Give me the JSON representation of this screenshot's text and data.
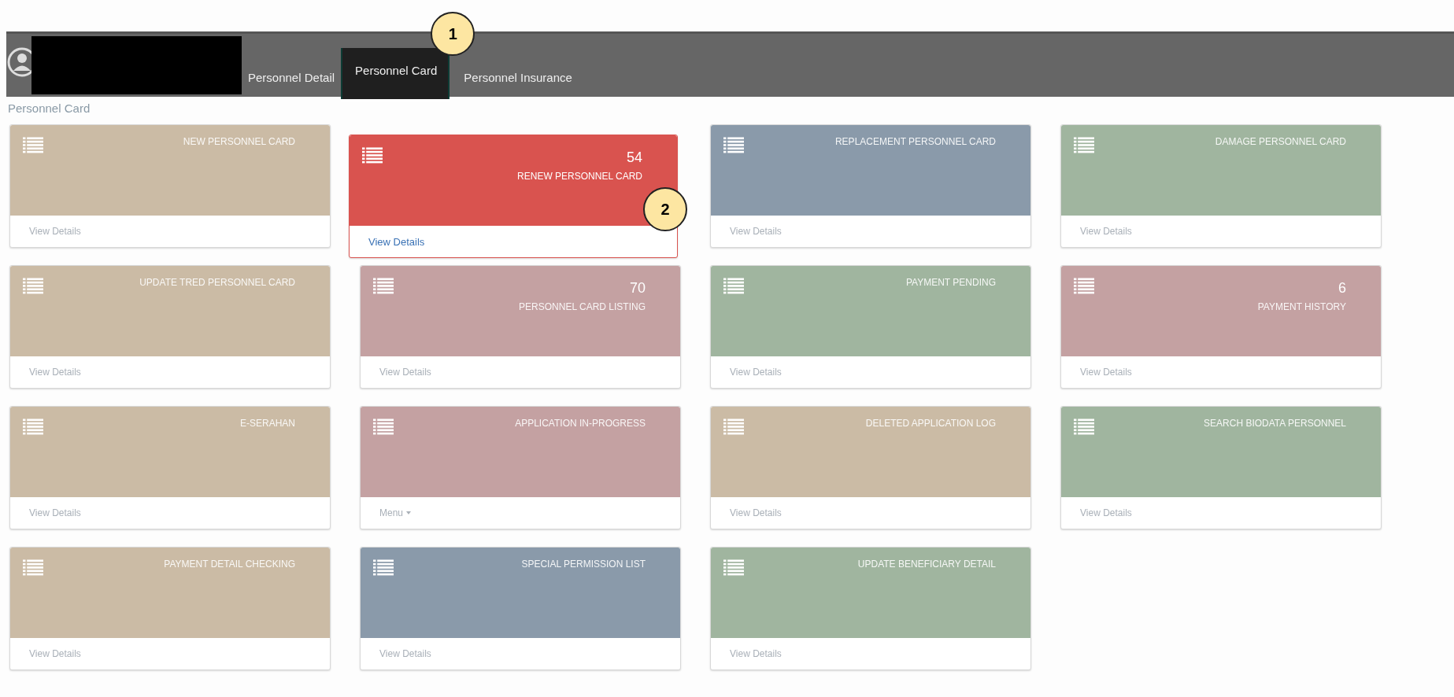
{
  "top_bar": {
    "tabs": [
      {
        "label": "Personnel Detail",
        "selected": false
      },
      {
        "label": "Personnel Card",
        "selected": true,
        "callout": "1"
      },
      {
        "label": "Personnel Insurance",
        "selected": false
      }
    ]
  },
  "breadcrumb": "Personnel Card",
  "tiles": [
    {
      "title": "NEW PERSONNEL CARD",
      "color": "#cbbba5",
      "kind": "details",
      "footer": "View Details",
      "highlighted": false
    },
    {
      "title": "RENEW PERSONNEL CARD",
      "count": "54",
      "color": "#d9534f",
      "kind": "details",
      "footer": "View Details",
      "highlighted": true,
      "callout": "2"
    },
    {
      "title": "REPLACEMENT PERSONNEL CARD",
      "color": "#8a9aaa",
      "kind": "details",
      "footer": "View Details",
      "highlighted": false
    },
    {
      "title": "DAMAGE PERSONNEL CARD",
      "color": "#a0b59f",
      "kind": "details",
      "footer": "View Details",
      "highlighted": false
    },
    {
      "title": "UPDATE TRED PERSONNEL CARD",
      "color": "#cbbba5",
      "kind": "details",
      "footer": "View Details",
      "highlighted": false
    },
    {
      "title": "PERSONNEL CARD LISTING",
      "count": "70",
      "color": "#c4a1a2",
      "kind": "details",
      "footer": "View Details",
      "highlighted": false
    },
    {
      "title": "PAYMENT PENDING",
      "color": "#a0b59f",
      "kind": "details",
      "footer": "View Details",
      "highlighted": false
    },
    {
      "title": "PAYMENT HISTORY",
      "count": "6",
      "color": "#c4a1a2",
      "kind": "details",
      "footer": "View Details",
      "highlighted": false
    },
    {
      "title": "E-SERAHAN",
      "color": "#cbbba5",
      "kind": "details",
      "footer": "View Details",
      "highlighted": false
    },
    {
      "title": "APPLICATION IN-PROGRESS",
      "color": "#c4a1a2",
      "kind": "menu",
      "footer": "Menu",
      "highlighted": false
    },
    {
      "title": "DELETED APPLICATION LOG",
      "color": "#cbbba5",
      "kind": "details",
      "footer": "View Details",
      "highlighted": false
    },
    {
      "title": "SEARCH BIODATA PERSONNEL",
      "color": "#a0b59f",
      "kind": "details",
      "footer": "View Details",
      "highlighted": false
    },
    {
      "title": "PAYMENT DETAIL CHECKING",
      "color": "#cbbba5",
      "kind": "details",
      "footer": "View Details",
      "highlighted": false
    },
    {
      "title": "SPECIAL PERMISSION LIST",
      "color": "#8a9aaa",
      "kind": "details",
      "footer": "View Details",
      "highlighted": false
    },
    {
      "title": "UPDATE BENEFICIARY DETAIL",
      "color": "#a0b59f",
      "kind": "details",
      "footer": "View Details",
      "highlighted": false
    }
  ]
}
